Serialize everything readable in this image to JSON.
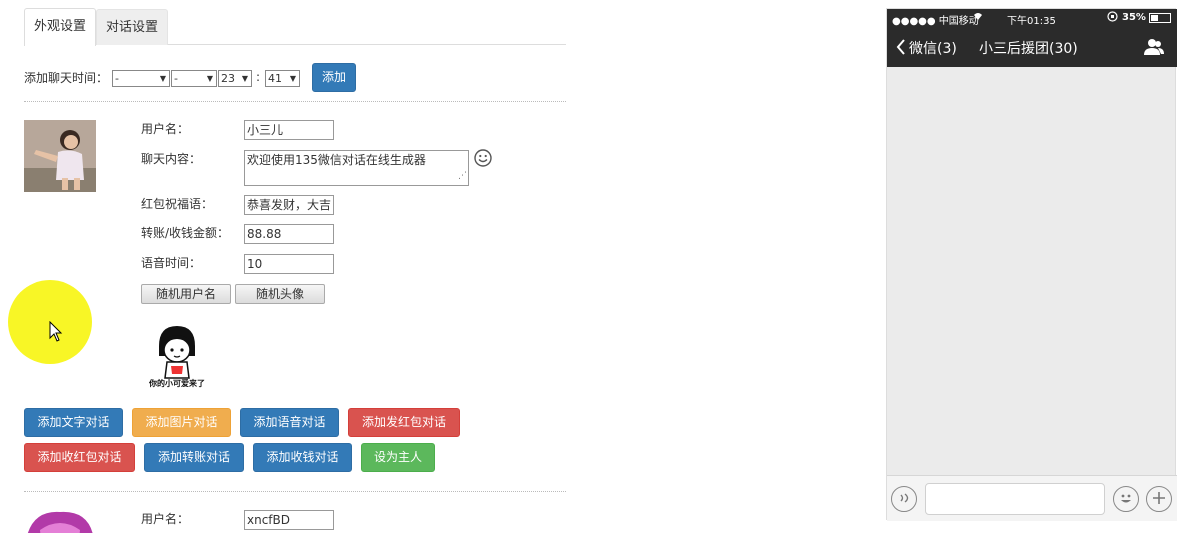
{
  "tabs": [
    {
      "label": "外观设置"
    },
    {
      "label": "对话设置"
    }
  ],
  "time_row": {
    "label": "添加聊天时间：",
    "selects": [
      "-",
      "-",
      "23",
      "41"
    ],
    "colon": ":",
    "add_button": "添加"
  },
  "entry1": {
    "labels": {
      "username": "用户名：",
      "content": "聊天内容：",
      "blessing": "红包祝福语：",
      "amount": "转账/收钱金额：",
      "voice_time": "语音时间："
    },
    "values": {
      "username": "小三儿",
      "content": "欢迎使用135微信对话在线生成器",
      "blessing": "恭喜发财，大吉",
      "amount": "88.88",
      "voice_time": "10"
    },
    "random_name_button": "随机用户名",
    "random_avatar_button": "随机头像",
    "sticker_caption": "你的小可爱来了"
  },
  "action_buttons": {
    "row1": [
      "添加文字对话",
      "添加图片对话",
      "添加语音对话",
      "添加发红包对话"
    ],
    "row2": [
      "添加收红包对话",
      "添加转账对话",
      "添加收钱对话",
      "设为主人"
    ]
  },
  "entry2": {
    "username_label": "用户名：",
    "username_value": "xncfBD"
  },
  "phone": {
    "status": {
      "carrier": "●●●●● 中国移动",
      "time": "下午01:35",
      "battery": "35%"
    },
    "nav": {
      "back": "微信(3)",
      "title": "小三后援团(30)"
    }
  },
  "colors": {
    "primary": "#337ab7",
    "warning": "#f0ad4e",
    "danger": "#d9534f",
    "success": "#5cb85c",
    "phone_bar": "#2b2b2b",
    "cursor_highlight": "#f7f500"
  }
}
